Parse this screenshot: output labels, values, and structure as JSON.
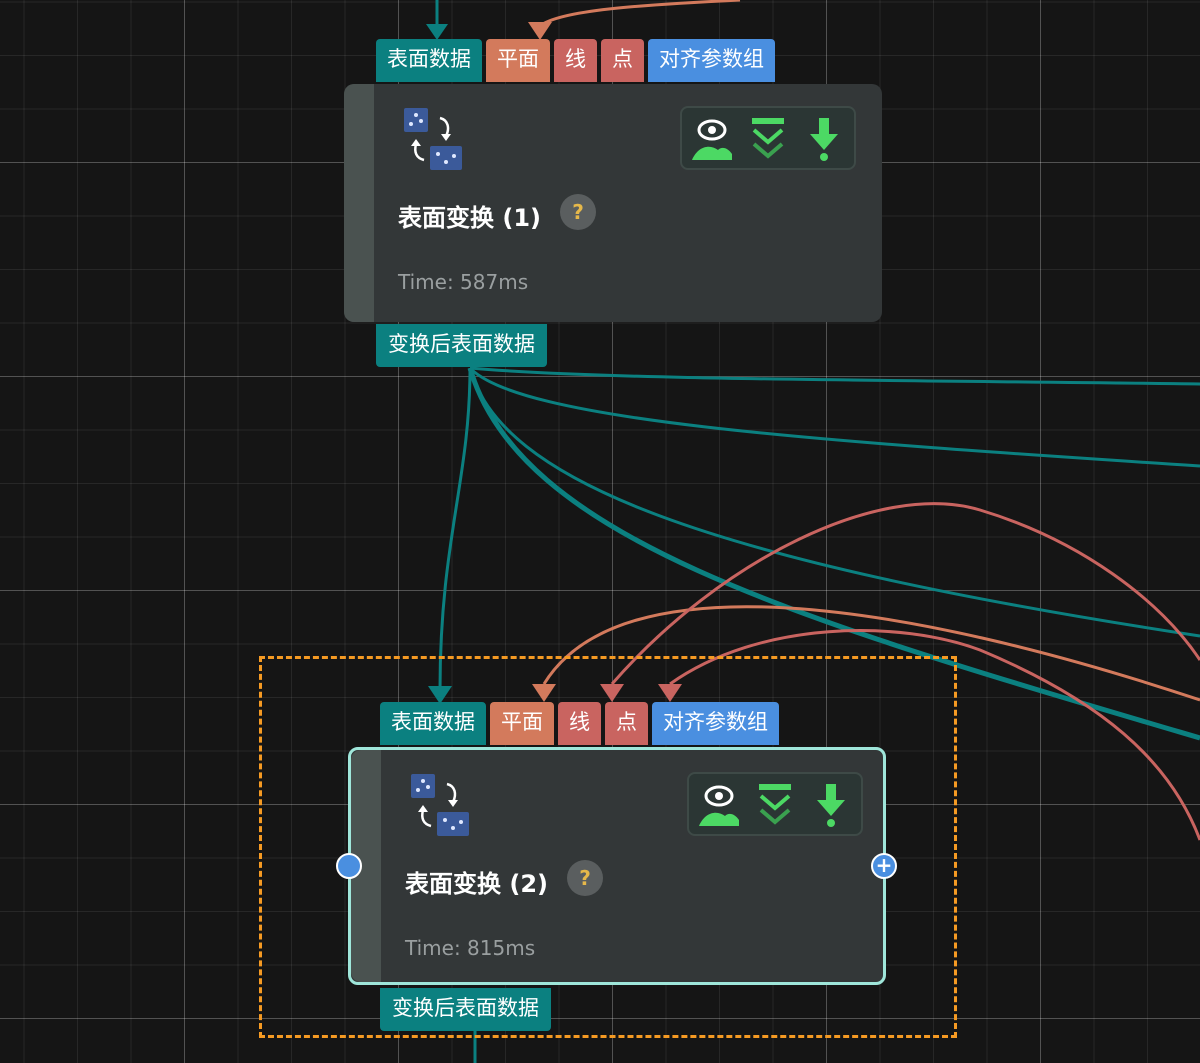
{
  "nodes": [
    {
      "title": "表面变换 (1)",
      "time": "Time: 587ms",
      "inputs": [
        "表面数据",
        "平面",
        "线",
        "点",
        "对齐参数组"
      ],
      "output": "变换后表面数据",
      "selected": false
    },
    {
      "title": "表面变换 (2)",
      "time": "Time: 815ms",
      "inputs": [
        "表面数据",
        "平面",
        "线",
        "点",
        "对齐参数组"
      ],
      "output": "变换后表面数据",
      "selected": true
    }
  ],
  "help_label": "?",
  "colors": {
    "background": "#151515",
    "surface_wire": "#0b8080",
    "plane_port": "#d37a5c",
    "line_point_port": "#c96460",
    "param_port": "#4a8fe0",
    "selection_border": "#f59a23",
    "selected_node_border": "#9fe6da",
    "action_green": "#4cd964"
  },
  "actions": [
    "eye-icon",
    "collapse-chevrons-icon",
    "download-arrow-icon"
  ]
}
